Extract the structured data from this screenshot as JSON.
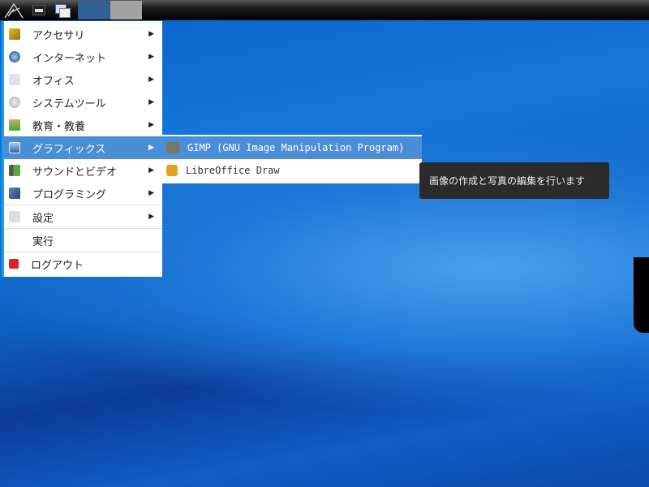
{
  "taskbar": {
    "buttons": [
      "menu-logo",
      "show-desktop",
      "window-switcher"
    ]
  },
  "menu": {
    "items": [
      {
        "label": "アクセサリ",
        "icon": "accessories-icon",
        "submenu": true
      },
      {
        "label": "インターネット",
        "icon": "globe-icon",
        "submenu": true
      },
      {
        "label": "オフィス",
        "icon": "office-icon",
        "submenu": true
      },
      {
        "label": "システムツール",
        "icon": "gear-icon",
        "submenu": true
      },
      {
        "label": "教育・教養",
        "icon": "education-icon",
        "submenu": true
      },
      {
        "label": "グラフィックス",
        "icon": "graphics-icon",
        "submenu": true
      },
      {
        "label": "サウンドとビデオ",
        "icon": "multimedia-icon",
        "submenu": true
      },
      {
        "label": "プログラミング",
        "icon": "programming-icon",
        "submenu": true
      },
      {
        "label": "設定",
        "icon": "settings-icon",
        "submenu": true
      },
      {
        "label": "実行",
        "icon": "",
        "submenu": false
      },
      {
        "label": "ログアウト",
        "icon": "logout-icon",
        "submenu": false
      }
    ]
  },
  "submenu": {
    "items": [
      {
        "label": "GIMP (GNU Image Manipulation Program)"
      },
      {
        "label": "LibreOffice Draw"
      }
    ]
  },
  "tooltip": "画像の作成と写真の編集を行います",
  "colors": {
    "highlight": "#4a8ed8",
    "tooltip_bg": "#2b2b2b"
  }
}
